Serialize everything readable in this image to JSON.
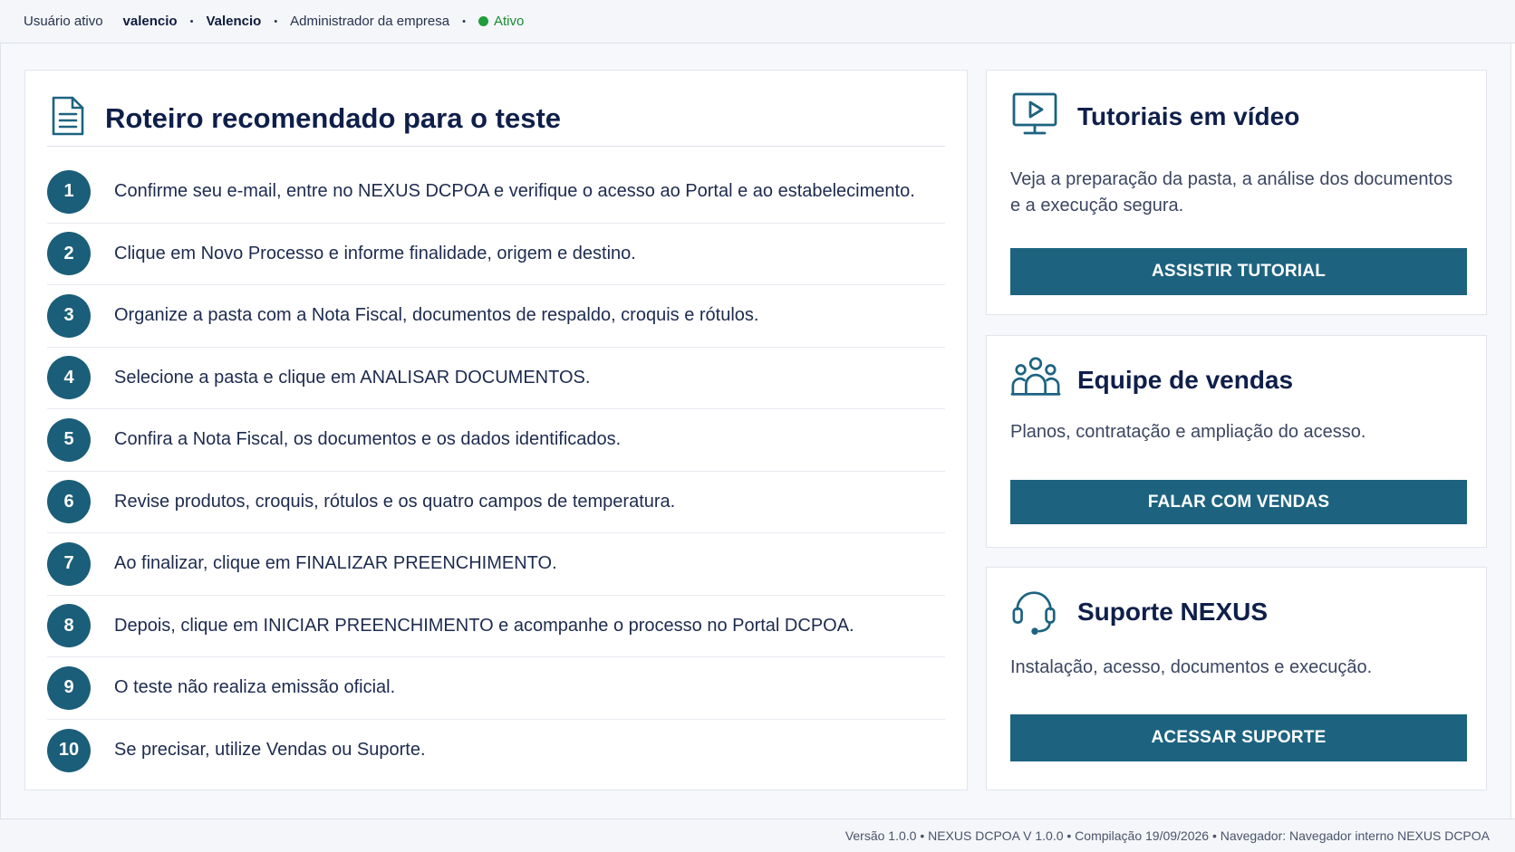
{
  "topbar": {
    "label": "Usuário ativo",
    "username": "valencio",
    "name": "Valencio",
    "role": "Administrador da empresa",
    "status": "Ativo",
    "separator": "•"
  },
  "guide": {
    "title": "Roteiro recomendado para o teste",
    "icon": "document-icon",
    "steps": [
      {
        "num": "1",
        "text": "Confirme seu e-mail, entre no NEXUS DCPOA e verifique o acesso ao Portal e ao estabelecimento."
      },
      {
        "num": "2",
        "text": "Clique em Novo Processo e informe finalidade, origem e destino."
      },
      {
        "num": "3",
        "text": "Organize a pasta com a Nota Fiscal, documentos de respaldo, croquis e rótulos."
      },
      {
        "num": "4",
        "text": "Selecione a pasta e clique em ANALISAR DOCUMENTOS."
      },
      {
        "num": "5",
        "text": "Confira a Nota Fiscal, os documentos e os dados identificados."
      },
      {
        "num": "6",
        "text": "Revise produtos, croquis, rótulos e os quatro campos de temperatura."
      },
      {
        "num": "7",
        "text": "Ao finalizar, clique em FINALIZAR PREENCHIMENTO."
      },
      {
        "num": "8",
        "text": "Depois, clique em INICIAR PREENCHIMENTO e acompanhe o processo no Portal DCPOA."
      },
      {
        "num": "9",
        "text": "O teste não realiza emissão oficial."
      },
      {
        "num": "10",
        "text": "Se precisar, utilize Vendas ou Suporte."
      }
    ]
  },
  "tutorials": {
    "icon": "video-monitor-icon",
    "title": "Tutoriais em vídeo",
    "description": "Veja a preparação da pasta, a análise dos documentos e a execução segura.",
    "button": "ASSISTIR TUTORIAL"
  },
  "sales": {
    "icon": "team-icon",
    "title": "Equipe de vendas",
    "description": "Planos, contratação e ampliação do acesso.",
    "button": "FALAR COM VENDAS"
  },
  "support": {
    "icon": "headset-icon",
    "title": "Suporte NEXUS",
    "description": "Instalação, acesso, documentos e execução.",
    "button": "ACESSAR SUPORTE"
  },
  "footer": {
    "text": "Versão 1.0.0 • NEXUS DCPOA V 1.0.0 • Compilação 19/09/2026 • Navegador: Navegador interno NEXUS DCPOA"
  },
  "colors": {
    "accent": "#1d6380",
    "step_circle": "#1b5e79",
    "status_green": "#1f9d3a",
    "title_navy": "#0f1f4a"
  }
}
